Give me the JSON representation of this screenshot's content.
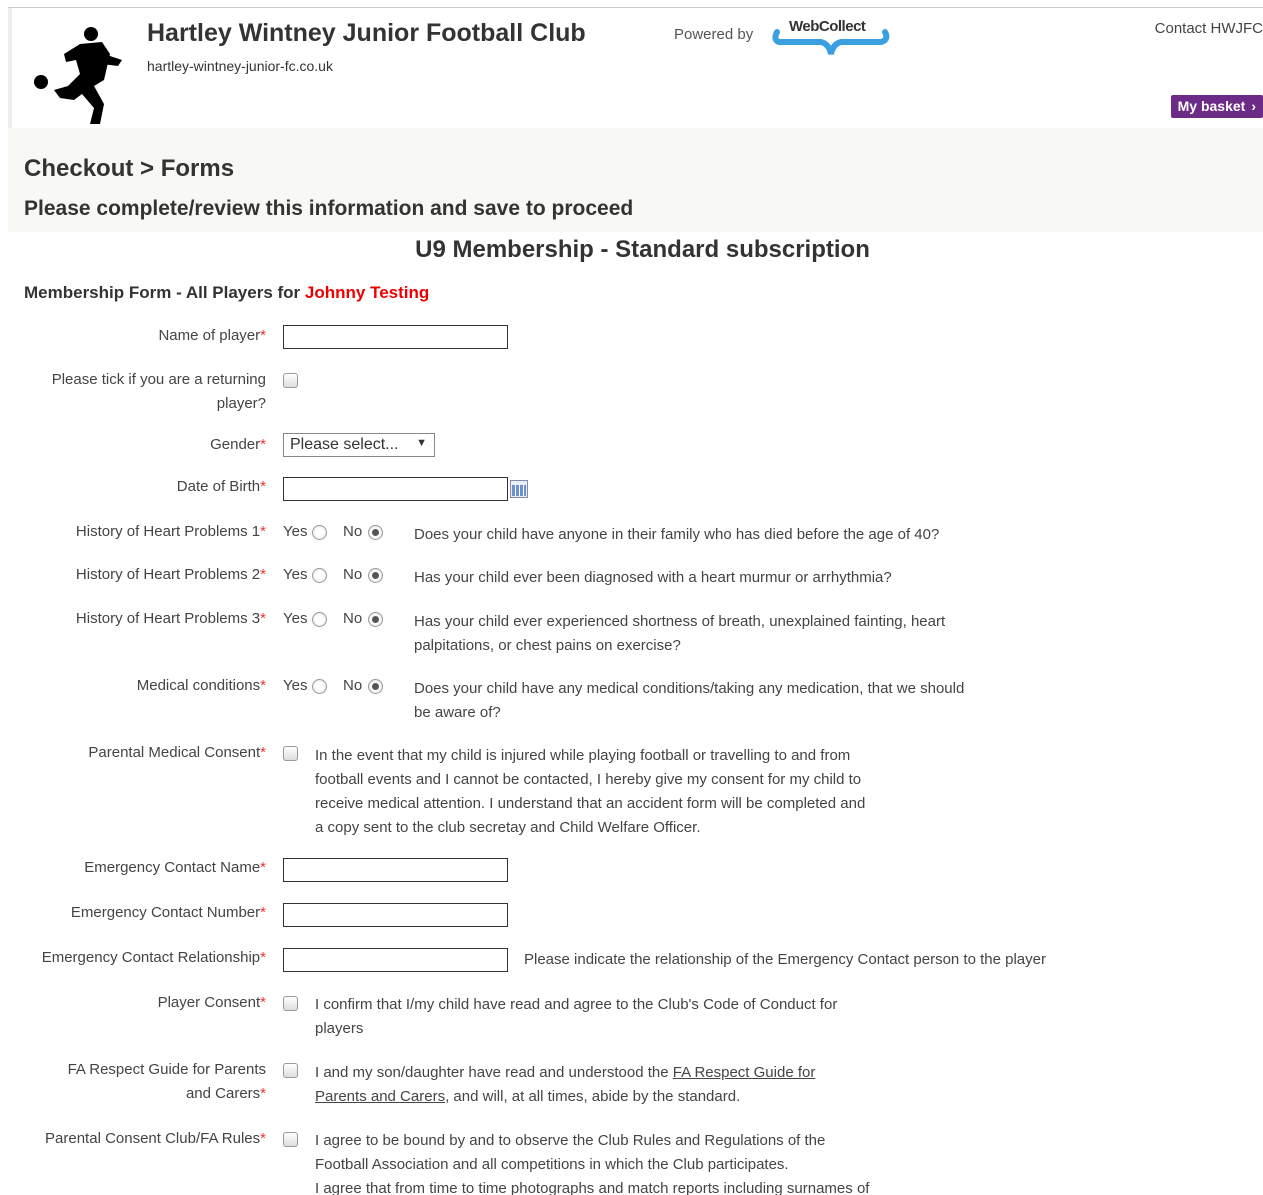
{
  "header": {
    "club_name": "Hartley Wintney Junior Football Club",
    "club_url": "hartley-wintney-junior-fc.co.uk",
    "powered_by": "Powered by",
    "powered_brand": "WebCollect",
    "contact": "Contact HWJFC",
    "basket": "My basket",
    "basket_chevron": "›"
  },
  "colors": {
    "basket": "#6c2b86",
    "required": "#e33",
    "player_name": "#e00"
  },
  "page": {
    "breadcrumb": "Checkout > Forms",
    "instruction": "Please complete/review this information and save to proceed",
    "product": "U9 Membership - Standard subscription",
    "form_title_prefix": "Membership Form - All Players for",
    "form_title_player": "Johnny Testing"
  },
  "required_mark": "*",
  "fields": {
    "name_of_player": {
      "label": "Name of player",
      "value": ""
    },
    "returning_player": {
      "label_1": "Please tick if you are a returning",
      "label_2": "player?",
      "checked": false
    },
    "gender": {
      "label": "Gender",
      "value": "Please select...",
      "arrow": "▼"
    },
    "dob": {
      "label": "Date of Birth",
      "value": ""
    },
    "radio_yes": "Yes",
    "radio_no": "No",
    "heart1": {
      "label": "History of Heart Problems 1",
      "selected": "No",
      "desc": "Does your child have anyone in their family who has died before the age of 40?"
    },
    "heart2": {
      "label": "History of Heart Problems 2",
      "selected": "No",
      "desc": "Has your child ever been diagnosed with a heart murmur or arrhythmia?"
    },
    "heart3": {
      "label": "History of Heart Problems 3",
      "selected": "No",
      "desc_1": "Has your child ever experienced shortness of breath, unexplained fainting, heart",
      "desc_2": "palpitations, or chest pains on exercise?"
    },
    "medical": {
      "label": "Medical conditions",
      "selected": "No",
      "desc_1": "Does your child have any medical conditions/taking any medication, that we should",
      "desc_2": "be aware of?"
    },
    "medical_consent": {
      "label": "Parental Medical Consent",
      "checked": false,
      "desc_1": "In the event that my child is injured while playing football or travelling to and from",
      "desc_2": "football events and I cannot be contacted, I hereby give my consent for my child to",
      "desc_3": "receive medical attention. I understand that an accident form will be completed and",
      "desc_4": "a copy sent to the club secretay and Child Welfare Officer."
    },
    "emergency_name": {
      "label": "Emergency Contact Name",
      "value": ""
    },
    "emergency_number": {
      "label": "Emergency Contact Number",
      "value": ""
    },
    "emergency_relationship": {
      "label": "Emergency Contact Relationship",
      "value": "",
      "hint": "Please indicate the relationship of the Emergency Contact person to the player"
    },
    "player_consent": {
      "label": "Player Consent",
      "checked": false,
      "desc_1": "I confirm that I/my child have read and agree to the Club's Code of Conduct for",
      "desc_2": "players"
    },
    "fa_respect": {
      "label_1": "FA Respect Guide for Parents",
      "label_2": "and Carers",
      "checked": false,
      "desc_1a": "I and my son/daughter have read and understood the ",
      "link_1": "FA Respect Guide for",
      "link_2": "Parents and Carers",
      "desc_2b": ", and will, at all times, abide by the standard."
    },
    "club_rules": {
      "label": "Parental Consent Club/FA Rules",
      "checked": false,
      "desc_1": "I agree to be bound by and to observe the Club Rules and Regulations of the",
      "desc_2": "Football Association and all competitions in which the Club participates.",
      "desc_3": "I agree that from time to time photographs and match reports including surnames of"
    }
  }
}
